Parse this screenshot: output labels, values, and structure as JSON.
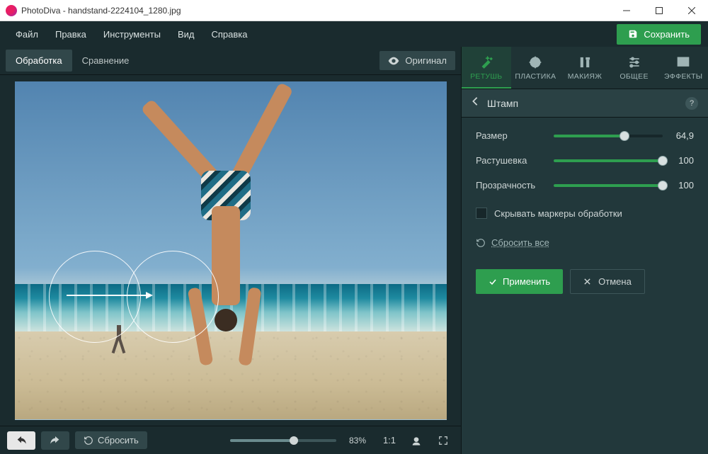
{
  "titlebar": {
    "title": "PhotoDiva - handstand-2224104_1280.jpg"
  },
  "menu": {
    "items": [
      "Файл",
      "Правка",
      "Инструменты",
      "Вид",
      "Справка"
    ],
    "save": "Сохранить"
  },
  "canvasTabs": {
    "edit": "Обработка",
    "compare": "Сравнение",
    "original": "Оригинал"
  },
  "bottom": {
    "reset": "Сбросить",
    "zoom": "83%",
    "oneToOne": "1:1"
  },
  "toolTabs": {
    "retouch": "РЕТУШЬ",
    "plastic": "ПЛАСТИКА",
    "makeup": "МАКИЯЖ",
    "general": "ОБЩЕЕ",
    "effects": "ЭФФЕКТЫ"
  },
  "panel": {
    "title": "Штамп",
    "sliders": {
      "size": {
        "label": "Размер",
        "value": "64,9",
        "pct": 65
      },
      "feather": {
        "label": "Растушевка",
        "value": "100",
        "pct": 100
      },
      "opacity": {
        "label": "Прозрачность",
        "value": "100",
        "pct": 100
      }
    },
    "hideMarkers": "Скрывать маркеры обработки",
    "resetAll": "Сбросить все",
    "apply": "Применить",
    "cancel": "Отмена"
  }
}
